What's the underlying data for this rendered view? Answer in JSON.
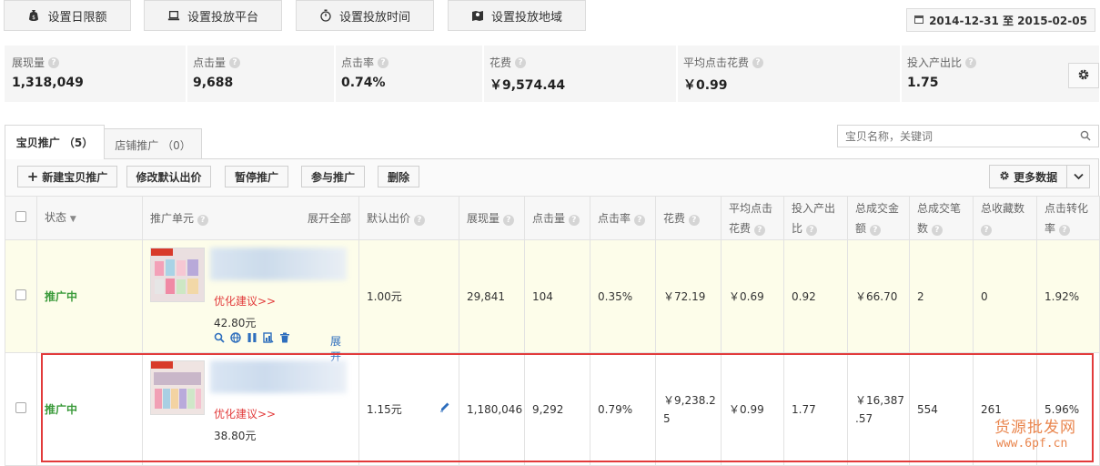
{
  "toolbar": {
    "daily_limit": "设置日限额",
    "platform": "设置投放平台",
    "time": "设置投放时间",
    "region": "设置投放地域",
    "date_range": "2014-12-31 至 2015-02-05"
  },
  "metrics": [
    {
      "label": "展现量",
      "value": "1,318,049"
    },
    {
      "label": "点击量",
      "value": "9,688"
    },
    {
      "label": "点击率",
      "value": "0.74%"
    },
    {
      "label": "花费",
      "value": "￥9,574.44"
    },
    {
      "label": "平均点击花费",
      "value": "￥0.99"
    },
    {
      "label": "投入产出比",
      "value": "1.75"
    }
  ],
  "tabs": {
    "items": "宝贝推广 （5）",
    "shop": "店铺推广 （0）"
  },
  "search": {
    "placeholder": "宝贝名称，关键词"
  },
  "actions": {
    "new": "新建宝贝推广",
    "modify_bid": "修改默认出价",
    "pause": "暂停推广",
    "join": "参与推广",
    "delete": "删除",
    "more_data": "更多数据"
  },
  "columns": {
    "status": "状态",
    "unit": "推广单元",
    "expand_all": "展开全部",
    "bid": "默认出价",
    "impressions": "展现量",
    "clicks": "点击量",
    "ctr": "点击率",
    "cost": "花费",
    "avg_cpc_1": "平均点击",
    "avg_cpc_2": "花费",
    "roi_1": "投入产出",
    "roi_2": "比",
    "gmv_1": "总成交金",
    "gmv_2": "额",
    "orders_1": "总成交笔",
    "orders_2": "数",
    "favorites": "总收藏数",
    "cvr_1": "点击转化",
    "cvr_2": "率"
  },
  "rows": [
    {
      "status": "推广中",
      "suggest": "优化建议>>",
      "price": "42.80元",
      "expand": "展开",
      "bid": "1.00元",
      "impressions": "29,841",
      "clicks": "104",
      "ctr": "0.35%",
      "cost": "￥72.19",
      "avg_cpc": "￥0.69",
      "roi": "0.92",
      "gmv": "￥66.70",
      "orders": "2",
      "favorites": "0",
      "cvr": "1.92%"
    },
    {
      "status": "推广中",
      "suggest": "优化建议>>",
      "price": "38.80元",
      "bid": "1.15元",
      "impressions": "1,180,046",
      "clicks": "9,292",
      "ctr": "0.79%",
      "cost_1": "￥9,238.2",
      "cost_2": "5",
      "avg_cpc": "￥0.99",
      "roi": "1.77",
      "gmv_1": "￥16,387",
      "gmv_2": ".57",
      "orders": "554",
      "favorites": "261",
      "cvr": "5.96%"
    }
  ],
  "watermark": {
    "line1": "货源批发网",
    "line2": "www.6pf.cn"
  }
}
